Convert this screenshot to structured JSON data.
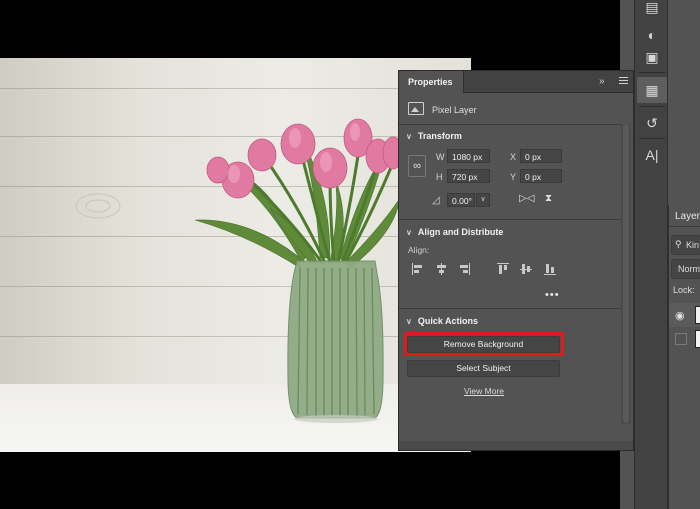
{
  "properties_panel": {
    "tab_title": "Properties",
    "collapse_glyph": "»",
    "layer_type_label": "Pixel Layer",
    "transform": {
      "header": "Transform",
      "w_label": "W",
      "w_value": "1080 px",
      "h_label": "H",
      "h_value": "720 px",
      "x_label": "X",
      "x_value": "0 px",
      "y_label": "Y",
      "y_value": "0 px",
      "angle_value": "0.00°"
    },
    "align": {
      "header": "Align and Distribute",
      "label": "Align:",
      "more_glyph": "•••"
    },
    "quick_actions": {
      "header": "Quick Actions",
      "remove_background": "Remove Background",
      "select_subject": "Select Subject",
      "view_more": "View More"
    }
  },
  "layers_panel": {
    "tab_title": "Layers",
    "kind_text": "Kin",
    "blend_text": "Norma",
    "lock_label": "Lock:"
  },
  "icons": {
    "strip": [
      "notes-icon",
      "adjustments-icon",
      "swatches-icon",
      "histogram-icon",
      "history-icon",
      "character-icon"
    ],
    "character_glyph": "A|",
    "eye_glyph": "👁"
  },
  "colors": {
    "panel_bg": "#535353",
    "panel_header": "#424242",
    "field_bg": "#454545",
    "highlight_red": "#e01b1b"
  }
}
